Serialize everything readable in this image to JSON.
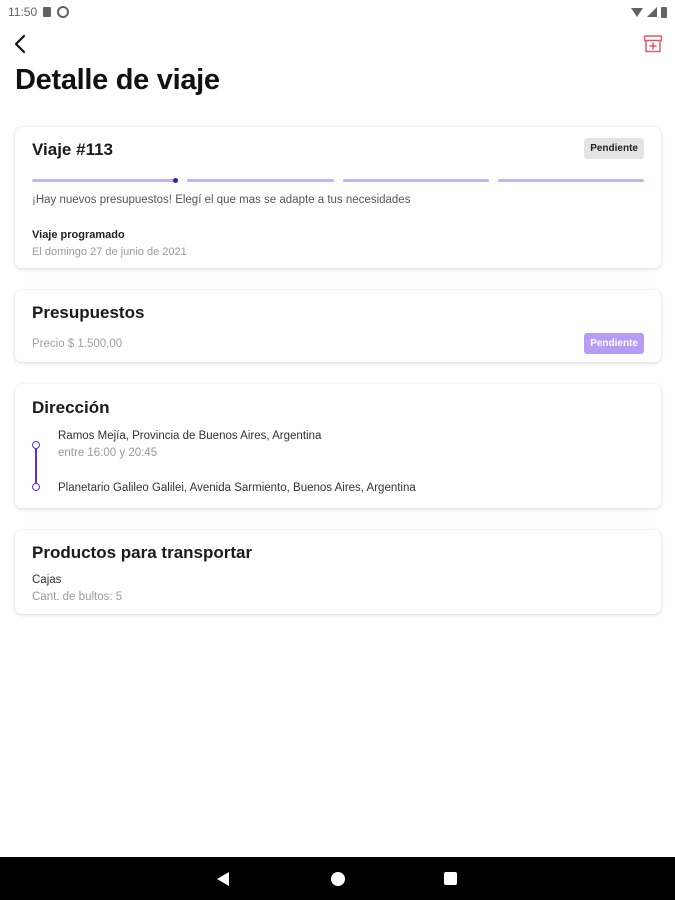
{
  "status_bar": {
    "time": "11:50"
  },
  "header": {
    "title": "Detalle de viaje"
  },
  "trip": {
    "title": "Viaje #113",
    "badge": "Pendiente",
    "progress_total_steps": 4,
    "progress_current_step": 1,
    "message": "¡Hay nuevos presupuestos! Elegí el que mas se adapte a tus necesidades",
    "schedule_label": "Viaje programado",
    "schedule_date": "El domingo 27 de junio de 2021"
  },
  "budgets": {
    "title": "Presupuestos",
    "price": "Precio $ 1.500,00",
    "badge": "Pendiente"
  },
  "address": {
    "title": "Dirección",
    "origin": "Ramos Mejía, Provincia de Buenos Aires, Argentina",
    "time_window": "entre 16:00 y 20:45",
    "destination": "Planetario Galileo Galilei, Avenida Sarmiento, Buenos Aires, Argentina"
  },
  "products": {
    "title": "Productos para transportar",
    "name": "Cajas",
    "quantity": "Cant. de bultos: 5"
  },
  "colors": {
    "accent": "#5b2ee0",
    "accent_light": "#c3b3f4",
    "badge_purple": "#b69cf5",
    "badge_grey": "#e4e4e4",
    "archive_icon": "#e05a6a"
  }
}
